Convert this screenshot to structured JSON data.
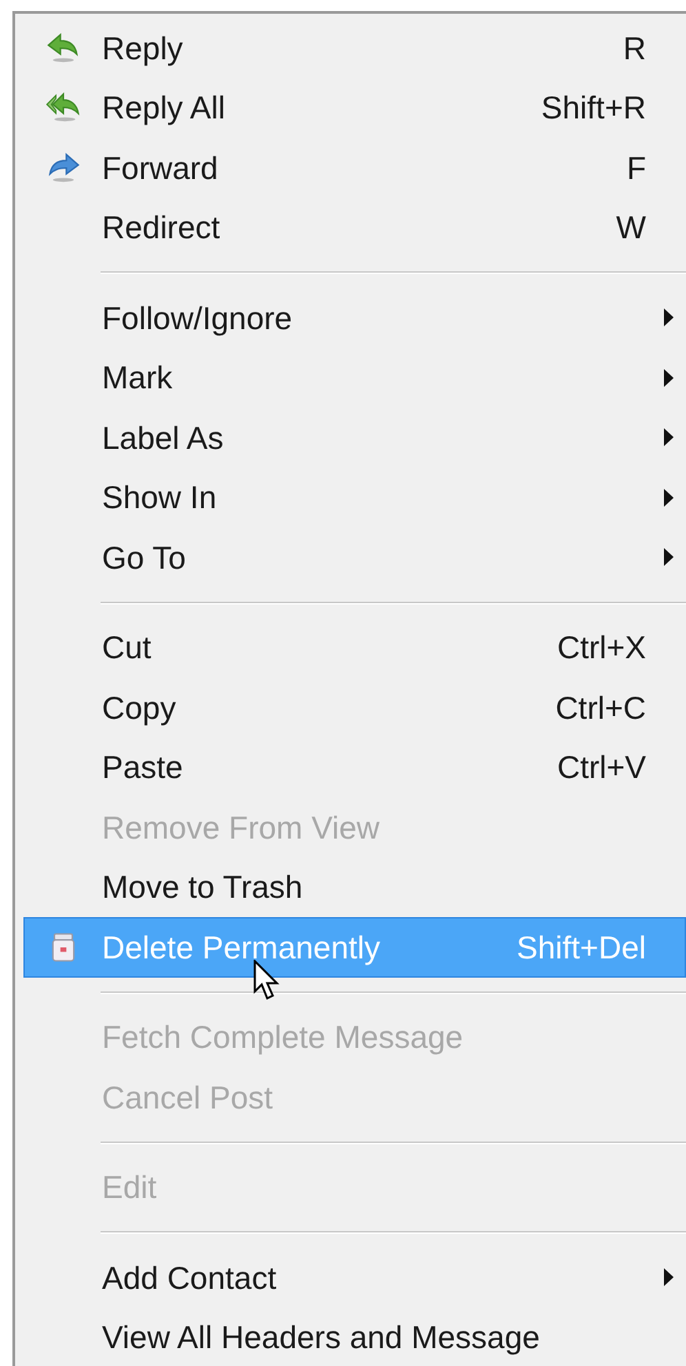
{
  "menu": {
    "sections": [
      {
        "items": [
          {
            "label": "Reply",
            "shortcut": "R",
            "kind": "reply",
            "submenu": false,
            "disabled": false,
            "selected": false
          },
          {
            "label": "Reply All",
            "shortcut": "Shift+R",
            "kind": "reply_all",
            "submenu": false,
            "disabled": false,
            "selected": false
          },
          {
            "label": "Forward",
            "shortcut": "F",
            "kind": "forward",
            "submenu": false,
            "disabled": false,
            "selected": false
          },
          {
            "label": "Redirect",
            "shortcut": "W",
            "submenu": false,
            "disabled": false,
            "selected": false
          }
        ]
      },
      {
        "items": [
          {
            "label": "Follow/Ignore",
            "submenu": true,
            "disabled": false,
            "selected": false
          },
          {
            "label": "Mark",
            "submenu": true,
            "disabled": false,
            "selected": false
          },
          {
            "label": "Label As",
            "submenu": true,
            "disabled": false,
            "selected": false
          },
          {
            "label": "Show In",
            "submenu": true,
            "disabled": false,
            "selected": false
          },
          {
            "label": "Go To",
            "submenu": true,
            "disabled": false,
            "selected": false
          }
        ]
      },
      {
        "items": [
          {
            "label": "Cut",
            "shortcut": "Ctrl+X",
            "submenu": false,
            "disabled": false,
            "selected": false
          },
          {
            "label": "Copy",
            "shortcut": "Ctrl+C",
            "submenu": false,
            "disabled": false,
            "selected": false
          },
          {
            "label": "Paste",
            "shortcut": "Ctrl+V",
            "submenu": false,
            "disabled": false,
            "selected": false
          },
          {
            "label": "Remove From View",
            "submenu": false,
            "disabled": true,
            "selected": false
          },
          {
            "label": "Move to Trash",
            "submenu": false,
            "disabled": false,
            "selected": false
          },
          {
            "label": "Delete Permanently",
            "shortcut": "Shift+Del",
            "kind": "trash",
            "submenu": false,
            "disabled": false,
            "selected": true
          }
        ]
      },
      {
        "items": [
          {
            "label": "Fetch Complete Message",
            "submenu": false,
            "disabled": true,
            "selected": false
          },
          {
            "label": "Cancel Post",
            "submenu": false,
            "disabled": true,
            "selected": false
          }
        ]
      },
      {
        "items": [
          {
            "label": "Edit",
            "submenu": false,
            "disabled": true,
            "selected": false
          }
        ]
      },
      {
        "items": [
          {
            "label": "Add Contact",
            "submenu": true,
            "disabled": false,
            "selected": false
          },
          {
            "label": "View All Headers and Message",
            "submenu": false,
            "disabled": false,
            "selected": false
          }
        ]
      }
    ]
  }
}
